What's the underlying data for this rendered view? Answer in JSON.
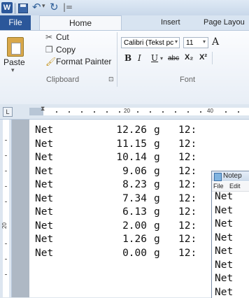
{
  "titlebar": {
    "app_icon_letter": "W",
    "qat_separator": "|",
    "undo_glyph": "↶",
    "undo_dropdown": "▾",
    "redo_glyph": "↻",
    "customize_glyph": "|=",
    "save_icon": "save-icon"
  },
  "tabs": {
    "file": "File",
    "home": "Home",
    "insert": "Insert",
    "page_layout": "Page Layou"
  },
  "clipboard": {
    "paste": "Paste",
    "paste_arrow": "▾",
    "cut": "Cut",
    "copy": "Copy",
    "format_painter": "Format Painter",
    "group_label": "Clipboard",
    "launcher": "⊡"
  },
  "font": {
    "name": "Calibri (Tekst pc",
    "size": "11",
    "grow": "A",
    "bold": "B",
    "italic": "I",
    "underline": "U",
    "underline_dd": "▾",
    "strike": "abc",
    "subscript": "X₂",
    "superscript": "X²",
    "group_label": "Font",
    "dd": "▾"
  },
  "ruler": {
    "tab_selector": "L",
    "num_20": "20",
    "num_40": "40",
    "v_num": "20"
  },
  "document": {
    "lines": [
      {
        "label": "Net",
        "value": "12.26",
        "unit": "g",
        "tail": "12:"
      },
      {
        "label": "Net",
        "value": "11.15",
        "unit": "g",
        "tail": "12:"
      },
      {
        "label": "Net",
        "value": "10.14",
        "unit": "g",
        "tail": "12:"
      },
      {
        "label": "Net",
        "value": "9.06",
        "unit": "g",
        "tail": "12:"
      },
      {
        "label": "Net",
        "value": "8.23",
        "unit": "g",
        "tail": "12:"
      },
      {
        "label": "Net",
        "value": "7.34",
        "unit": "g",
        "tail": "12:"
      },
      {
        "label": "Net",
        "value": "6.13",
        "unit": "g",
        "tail": "12:"
      },
      {
        "label": "Net",
        "value": "2.00",
        "unit": "g",
        "tail": "12:"
      },
      {
        "label": "Net",
        "value": "1.26",
        "unit": "g",
        "tail": "12:"
      },
      {
        "label": "Net",
        "value": "0.00",
        "unit": "g",
        "tail": "12:"
      }
    ]
  },
  "notepad": {
    "title": "Notep",
    "menu_file": "File",
    "menu_edit": "Edit",
    "lines": [
      "Net",
      "Net",
      "Net",
      "Net",
      "Net",
      "Net",
      "Net",
      "Net"
    ]
  }
}
